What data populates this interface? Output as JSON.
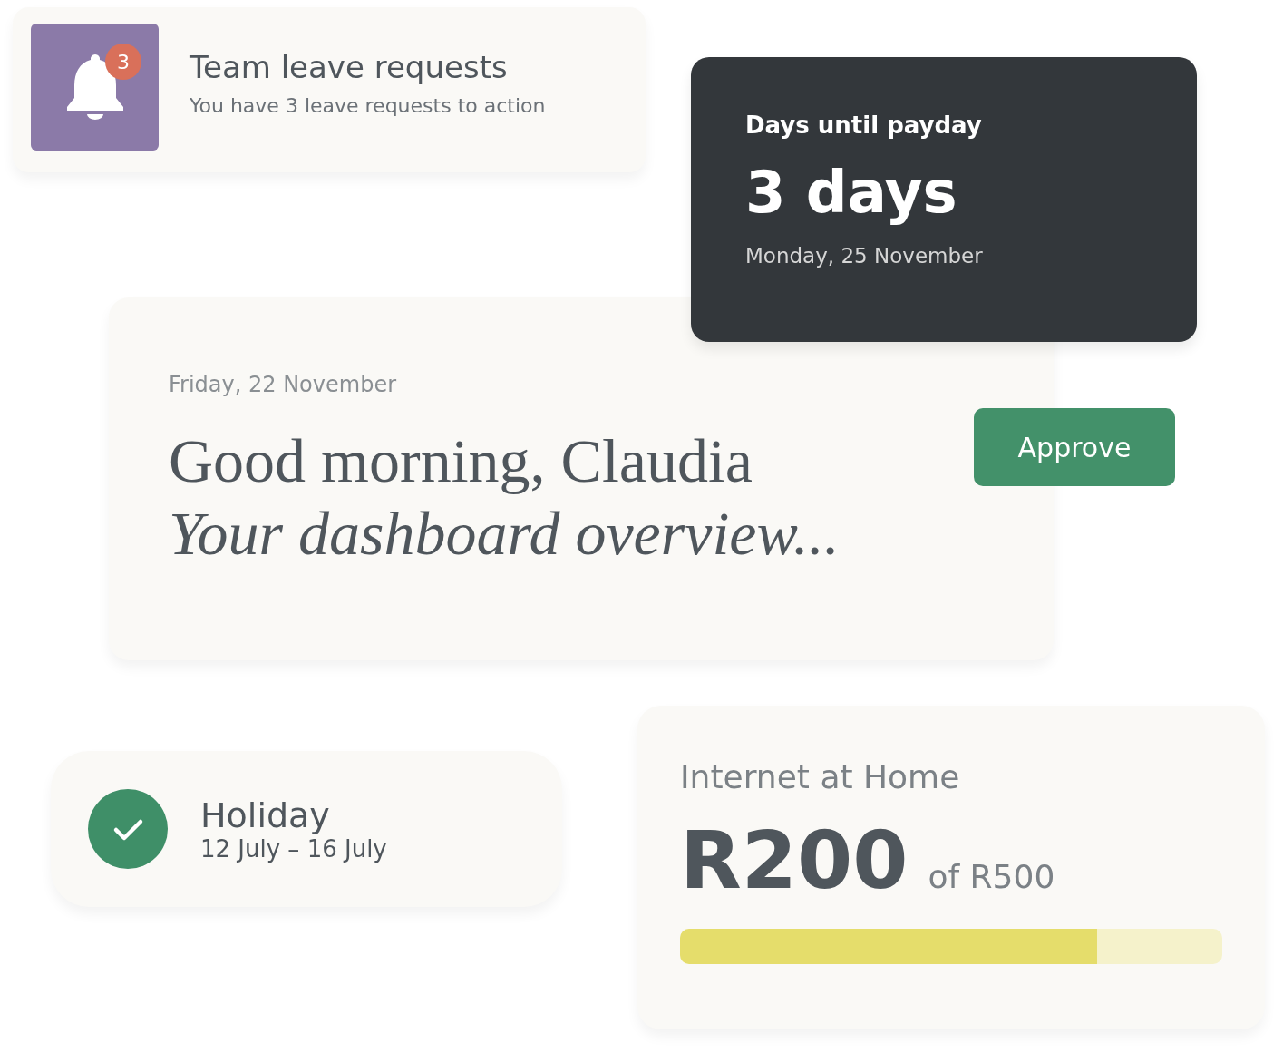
{
  "leave_card": {
    "badge": "3",
    "title": "Team leave requests",
    "subtitle": "You have 3 leave requests to action"
  },
  "greeting_card": {
    "date": "Friday, 22 November",
    "greeting": "Good morning, Claudia",
    "subtitle": "Your dashboard overview..."
  },
  "payday_card": {
    "label": "Days until payday",
    "value": "3 days",
    "date": "Monday, 25 November"
  },
  "approve_button": "Approve",
  "holiday_card": {
    "title": "Holiday",
    "dates": "12 July – 16 July"
  },
  "allowance_card": {
    "title": "Internet at Home",
    "amount": "R200",
    "limit": "of R500",
    "level": 0.77
  }
}
